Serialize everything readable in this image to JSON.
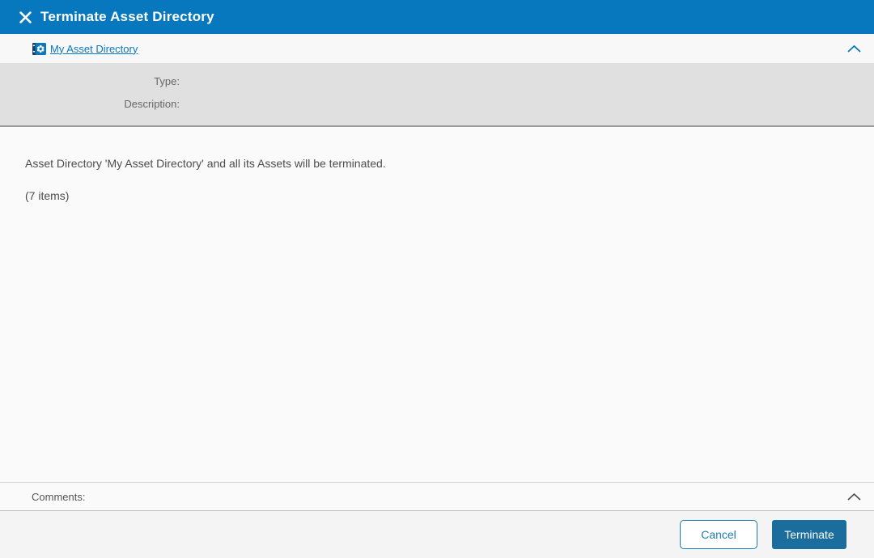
{
  "colors": {
    "titlebar_bg": "#0878be",
    "link_blue": "#0b78bd",
    "props_panel_bg": "#e0e0e0",
    "props_panel_border": "#9e9e9e",
    "terminate_button_bg": "#1b6d9e",
    "cancel_button_border": "#1c7ab0",
    "footer_bg": "#f4f4f4"
  },
  "header": {
    "title": "Terminate Asset Directory"
  },
  "asset_panel": {
    "link_label": "My Asset Directory",
    "icon": "asset-directory-icon",
    "collapse_icon": "chevron-up"
  },
  "properties": {
    "fields": [
      {
        "label": "Type:",
        "value": ""
      },
      {
        "label": "Description:",
        "value": ""
      }
    ]
  },
  "main": {
    "message": "Asset Directory 'My Asset Directory' and all its Assets will be terminated.",
    "items_count": "(7 items)"
  },
  "comments": {
    "label": "Comments:",
    "collapse_icon": "chevron-up"
  },
  "footer": {
    "cancel_label": "Cancel",
    "terminate_label": "Terminate"
  }
}
